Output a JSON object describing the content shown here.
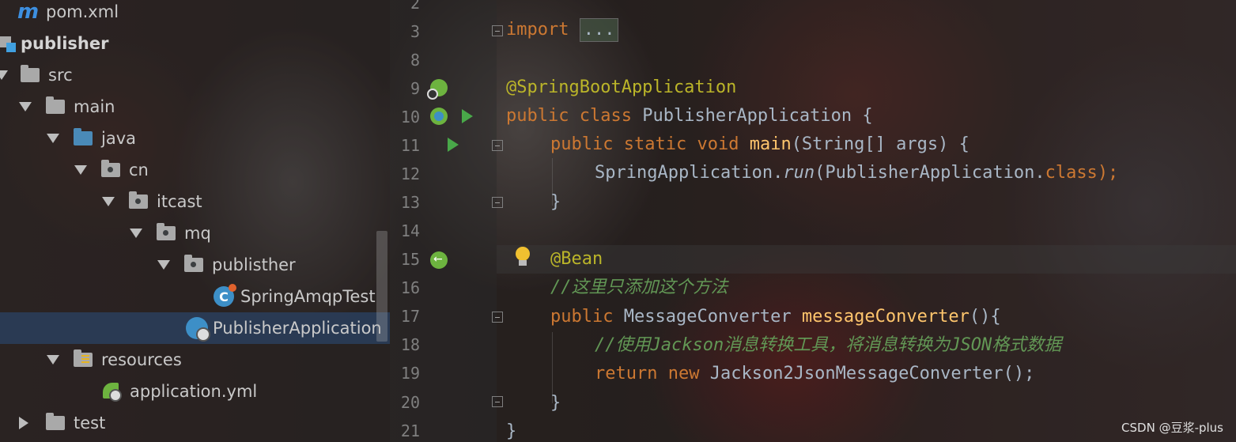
{
  "project_tree": {
    "items": [
      {
        "label": "pom.xml",
        "icon": "maven-icon"
      },
      {
        "label": "publisher",
        "icon": "module-icon"
      },
      {
        "label": "src",
        "icon": "folder-icon"
      },
      {
        "label": "main",
        "icon": "folder-icon"
      },
      {
        "label": "java",
        "icon": "source-folder-icon"
      },
      {
        "label": "cn",
        "icon": "package-icon"
      },
      {
        "label": "itcast",
        "icon": "package-icon"
      },
      {
        "label": "mq",
        "icon": "package-icon"
      },
      {
        "label": "publisther",
        "icon": "package-icon"
      },
      {
        "label": "SpringAmqpTest",
        "icon": "class-icon"
      },
      {
        "label": "PublisherApplication",
        "icon": "spring-boot-class-icon",
        "selected": true
      },
      {
        "label": "resources",
        "icon": "resources-folder-icon"
      },
      {
        "label": "application.yml",
        "icon": "spring-yml-icon"
      },
      {
        "label": "test",
        "icon": "folder-icon"
      }
    ],
    "maven_glyph": "m",
    "class_glyph": "C"
  },
  "editor": {
    "line_numbers": [
      "2",
      "3",
      "8",
      "9",
      "10",
      "11",
      "12",
      "13",
      "14",
      "15",
      "16",
      "17",
      "18",
      "19",
      "20",
      "21"
    ],
    "code": {
      "l3_import": "import",
      "l3_fold": "...",
      "l9_annotation": "@SpringBootApplication",
      "l10_public": "public",
      "l10_class": "class",
      "l10_name": " PublisherApplication {",
      "l11_public": "public",
      "l11_static": "static",
      "l11_void": "void",
      "l11_main": "main",
      "l11_args": "(String[] args) {",
      "l12_app": "SpringApplication.",
      "l12_run": "run",
      "l12_arg": "(PublisherApplication.",
      "l12_class": "class",
      "l12_end": ");",
      "l13_brace": "}",
      "l15_annotation": "@Bean",
      "l16_comment": "//这里只添加这个方法",
      "l17_public": "public",
      "l17_type": " MessageConverter ",
      "l17_method": "messageConverter",
      "l17_end": "(){",
      "l18_comment": "//使用Jackson消息转换工具，将消息转换为JSON格式数据",
      "l19_return": "return",
      "l19_new": "new",
      "l19_rest": " Jackson2JsonMessageConverter();",
      "l20_brace": "}",
      "l21_brace": "}"
    }
  },
  "watermark": "CSDN @豆浆-plus",
  "colors": {
    "keyword": "#cc7832",
    "annotation": "#bbb529",
    "method": "#ffc66d",
    "comment": "#629755",
    "text": "#a9b7c6",
    "selection": "#2a3e5c"
  }
}
